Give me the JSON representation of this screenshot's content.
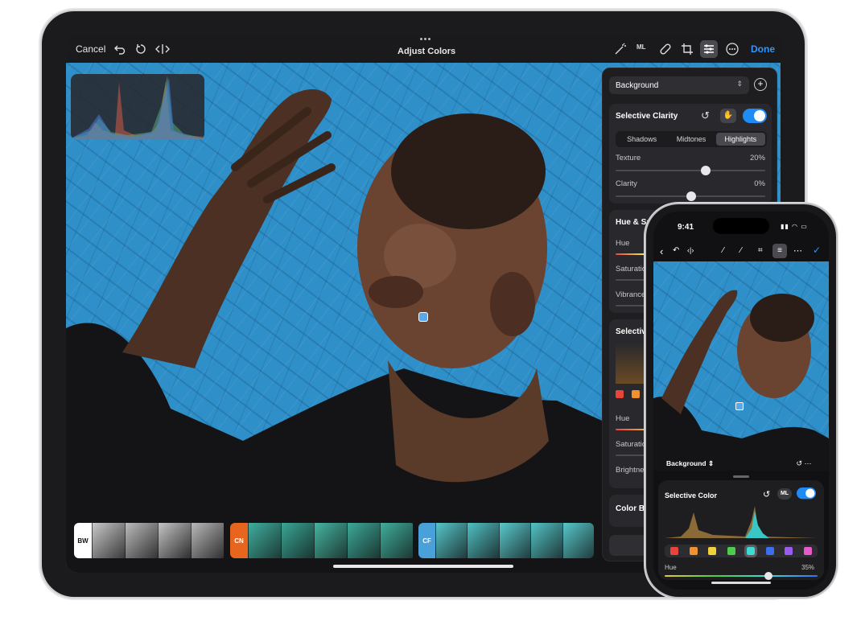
{
  "ipad": {
    "toolbar": {
      "cancel": "Cancel",
      "title": "Adjust Colors",
      "done": "Done",
      "ml_badge": "ML"
    },
    "panel": {
      "layer_select": "Background",
      "selective_clarity": {
        "title": "Selective Clarity",
        "segments": [
          "Shadows",
          "Midtones",
          "Highlights"
        ],
        "active_segment": "Highlights",
        "texture_label": "Texture",
        "texture_value": "20%",
        "clarity_label": "Clarity",
        "clarity_value": "0%"
      },
      "hue_sat": {
        "title": "Hue & Sat",
        "hue": "Hue",
        "saturation": "Saturation",
        "vibrance": "Vibrance"
      },
      "selective": {
        "title": "Selectiv",
        "hue": "Hue",
        "saturation": "Saturation",
        "brightness": "Brightnes"
      },
      "color_balance": "Color Ba",
      "bottom_button": "F"
    },
    "filmstrip": {
      "groups": [
        {
          "tag": "BW",
          "color": "#ffffff",
          "text_color": "#111111",
          "thumbs": 4,
          "tone": "bw"
        },
        {
          "tag": "CN",
          "color": "#e8651e",
          "text_color": "#ffffff",
          "thumbs": 5,
          "tone": "teal"
        },
        {
          "tag": "CF",
          "color": "#4aa0d8",
          "text_color": "#ffffff",
          "thumbs": 5,
          "tone": "cyan"
        }
      ]
    }
  },
  "phone": {
    "status": {
      "time": "9:41"
    },
    "layer_select": "Background",
    "selective_color": {
      "title": "Selective Color",
      "ml_badge": "ML",
      "swatches": [
        "#e8443a",
        "#f0912e",
        "#f2d23a",
        "#4ccc4a",
        "#3ddbd4",
        "#3a6ff0",
        "#9a5cf0",
        "#e85ac8"
      ],
      "active_swatch": 4,
      "hue_label": "Hue",
      "hue_value": "35%",
      "hue_fraction": 0.68
    }
  },
  "colors": {
    "accent": "#1f8cf5",
    "wall": "#2f8fc8"
  }
}
